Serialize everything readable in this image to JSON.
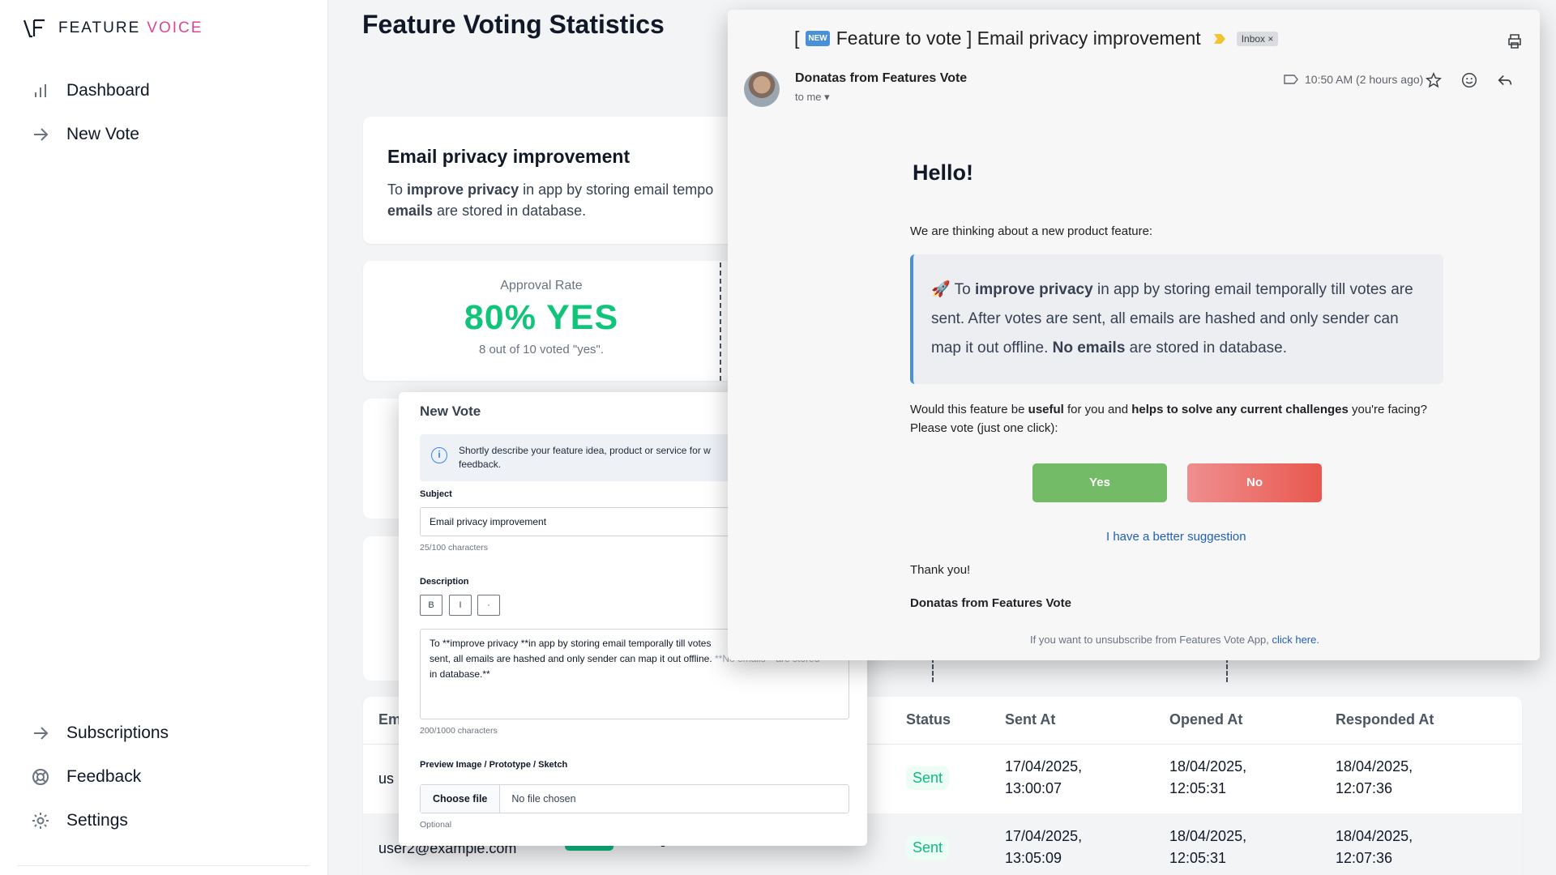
{
  "app": {
    "logo_word1": "FEATURE",
    "logo_word2": "VOICE",
    "accent_color": "#d9469a"
  },
  "sidebar": {
    "items": [
      {
        "label": "Dashboard",
        "icon": "bar-chart-icon"
      },
      {
        "label": "New Vote",
        "icon": "arrow-right-icon"
      }
    ],
    "bottom_items": [
      {
        "label": "Subscriptions",
        "icon": "arrow-right-icon"
      },
      {
        "label": "Feedback",
        "icon": "lifebuoy-icon"
      },
      {
        "label": "Settings",
        "icon": "gear-icon"
      }
    ]
  },
  "main": {
    "title": "Feature Voting Statistics",
    "feature": {
      "title": "Email privacy improvement",
      "desc_prefix": "To ",
      "desc_bold1": "improve privacy",
      "desc_mid": " in app by storing email tempo",
      "desc_bold2": "emails",
      "desc_end": " are stored in database."
    },
    "stats": {
      "label": "Approval Rate",
      "value": "80% YES",
      "sub": "8 out of 10 voted \"yes\".",
      "color": "#10c47a"
    },
    "table": {
      "headers": {
        "email": "Em",
        "status": "Status",
        "sent_at": "Sent At",
        "opened_at": "Opened At",
        "responded_at": "Responded At"
      },
      "rows": [
        {
          "email": "us",
          "status": "Sent",
          "sent_1": "17/04/2025,",
          "sent_2": "13:00:07",
          "opened_1": "18/04/2025,",
          "opened_2": "12:05:31",
          "responded_1": "18/04/2025,",
          "responded_2": "12:07:36"
        },
        {
          "email": "user2@example.com",
          "dash": "-",
          "status": "Sent",
          "sent_1": "17/04/2025,",
          "sent_2": "13:05:09",
          "opened_1": "18/04/2025,",
          "opened_2": "12:05:31",
          "responded_1": "18/04/2025,",
          "responded_2": "12:07:36"
        }
      ]
    }
  },
  "modal": {
    "title": "New Vote",
    "info": "Shortly describe your feature idea, product or service for w",
    "info_line2": "feedback.",
    "subject_label": "Subject",
    "subject_value": "Email privacy improvement",
    "subject_count": "25/100 characters",
    "description_label": "Description",
    "fmt_bold": "B",
    "fmt_italic": "I",
    "fmt_list": "·",
    "description_line1": "To **improve privacy **in app by storing email temporally till votes",
    "description_line2": "sent, all emails are hashed and only sender can map it out offline.",
    "description_line2_faded": " **No emails** are stored",
    "description_line3": "in database.**",
    "description_count": "200/1000 characters",
    "preview_label": "Preview Image / Prototype / Sketch",
    "file_button": "Choose file",
    "file_name": "No file chosen",
    "optional": "Optional"
  },
  "email": {
    "subject_prefix": "[",
    "new_tag": "NEW",
    "subject_text": " Feature to vote ] Email privacy improvement",
    "inbox_chip": "Inbox ×",
    "sender": "Donatas from Features Vote",
    "to": "to me ▾",
    "time": "10:50 AM (2 hours ago)",
    "hello": "Hello!",
    "intro": "We are thinking about a new product feature:",
    "quote_emoji": "🚀",
    "quote_pre": " To ",
    "quote_bold1": "improve privacy",
    "quote_mid": " in app by storing email temporally till votes are sent. After votes are sent, all emails are hashed and only sender can map it out offline. ",
    "quote_bold2": "No emails",
    "quote_end": " are stored in database.",
    "question_pre": "Would this feature be ",
    "question_bold1": "useful",
    "question_mid": " for you and ",
    "question_bold2": "helps to solve any current challenges",
    "question_end": " you're facing?",
    "question_line2": "Please vote (just one click):",
    "yes": "Yes",
    "no": "No",
    "suggest": "I have a better suggestion",
    "thanks": "Thank you!",
    "signature": "Donatas from Features Vote",
    "unsub": "If you want to unsubscribe from Features Vote App, ",
    "unsub_link": "click here."
  }
}
